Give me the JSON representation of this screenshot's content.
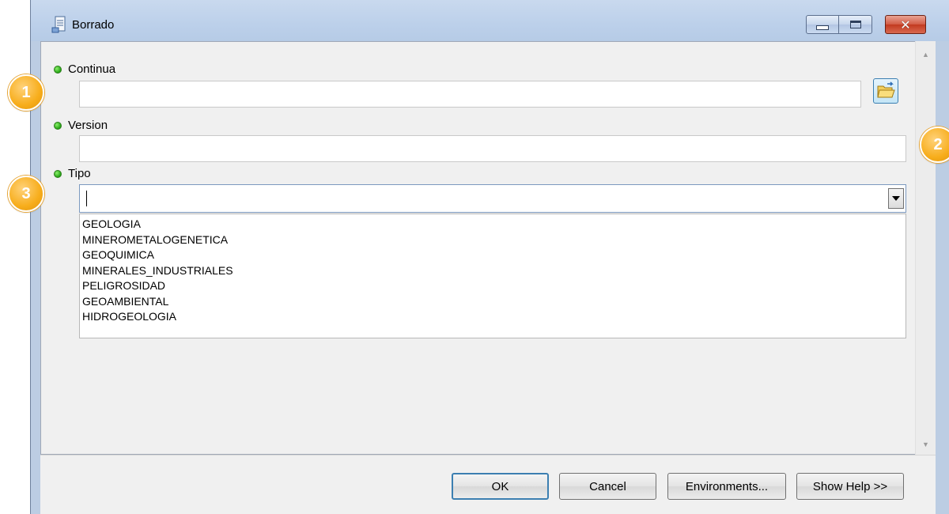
{
  "window": {
    "title": "Borrado",
    "icon": "script-tool-icon"
  },
  "params": [
    {
      "label": "Continua",
      "value": ""
    },
    {
      "label": "Version",
      "value": ""
    },
    {
      "label": "Tipo",
      "value": ""
    }
  ],
  "tipo_options": [
    "GEOLOGIA",
    "MINEROMETALOGENETICA",
    "GEOQUIMICA",
    "MINERALES_INDUSTRIALES",
    "PELIGROSIDAD",
    "GEOAMBIENTAL",
    "HIDROGEOLOGIA"
  ],
  "buttons": {
    "ok": "OK",
    "cancel": "Cancel",
    "environments": "Environments...",
    "show_help": "Show Help >>"
  },
  "callouts": [
    "1",
    "2",
    "3"
  ],
  "colors": {
    "required_dot": "#23a312",
    "callout": "#f7ad1b",
    "titlebar": "#bccde3"
  }
}
